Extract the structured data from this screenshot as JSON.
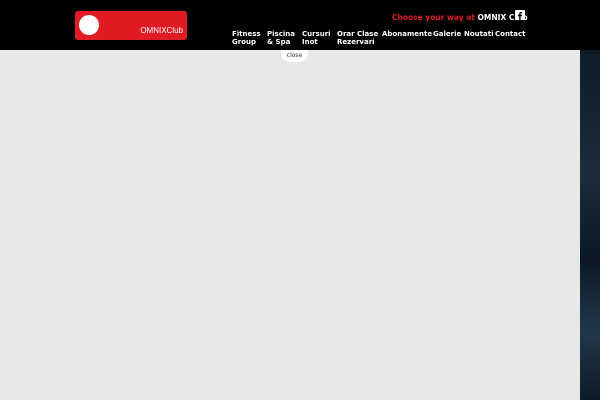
{
  "logo": {
    "text": "OMNIXClub"
  },
  "header": {
    "tagline_prefix": "Choose your way at ",
    "tagline_brand": "OMNIX Club",
    "social_icon": "facebook-icon"
  },
  "nav": {
    "items": [
      {
        "label": "Fitness\nGroup"
      },
      {
        "label": "Piscina\n& Spa"
      },
      {
        "label": "Cursuri\nInot"
      },
      {
        "label": "Orar Clase\nRezervari"
      },
      {
        "label": "Abonamente"
      },
      {
        "label": "Galerie"
      },
      {
        "label": "Noutati"
      },
      {
        "label": "Contact"
      }
    ]
  },
  "panel": {
    "close_label": "close"
  },
  "colors": {
    "brand_red": "#e11b24",
    "header_bg": "#000000",
    "content_bg": "#e8e8e8",
    "text_white": "#ffffff"
  }
}
